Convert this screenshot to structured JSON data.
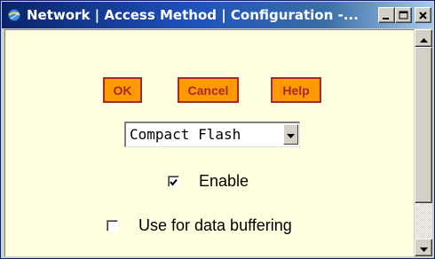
{
  "window": {
    "title": "Network | Access Method | Configuration -..."
  },
  "titlebar_buttons": {
    "minimize_icon": "minimize-icon",
    "maximize_icon": "maximize-icon",
    "close_icon": "close-icon"
  },
  "actions": {
    "ok_label": "OK",
    "cancel_label": "Cancel",
    "help_label": "Help"
  },
  "access_method": {
    "selected": "Compact Flash"
  },
  "options": {
    "enable_label": "Enable",
    "enable_checked": true,
    "buffer_label": "Use for data buffering",
    "buffer_checked": false
  },
  "colors": {
    "button_fill": "#ff9900",
    "button_text": "#a52a2a",
    "content_bg": "#ffffe0",
    "titlebar": "#0a246a"
  }
}
